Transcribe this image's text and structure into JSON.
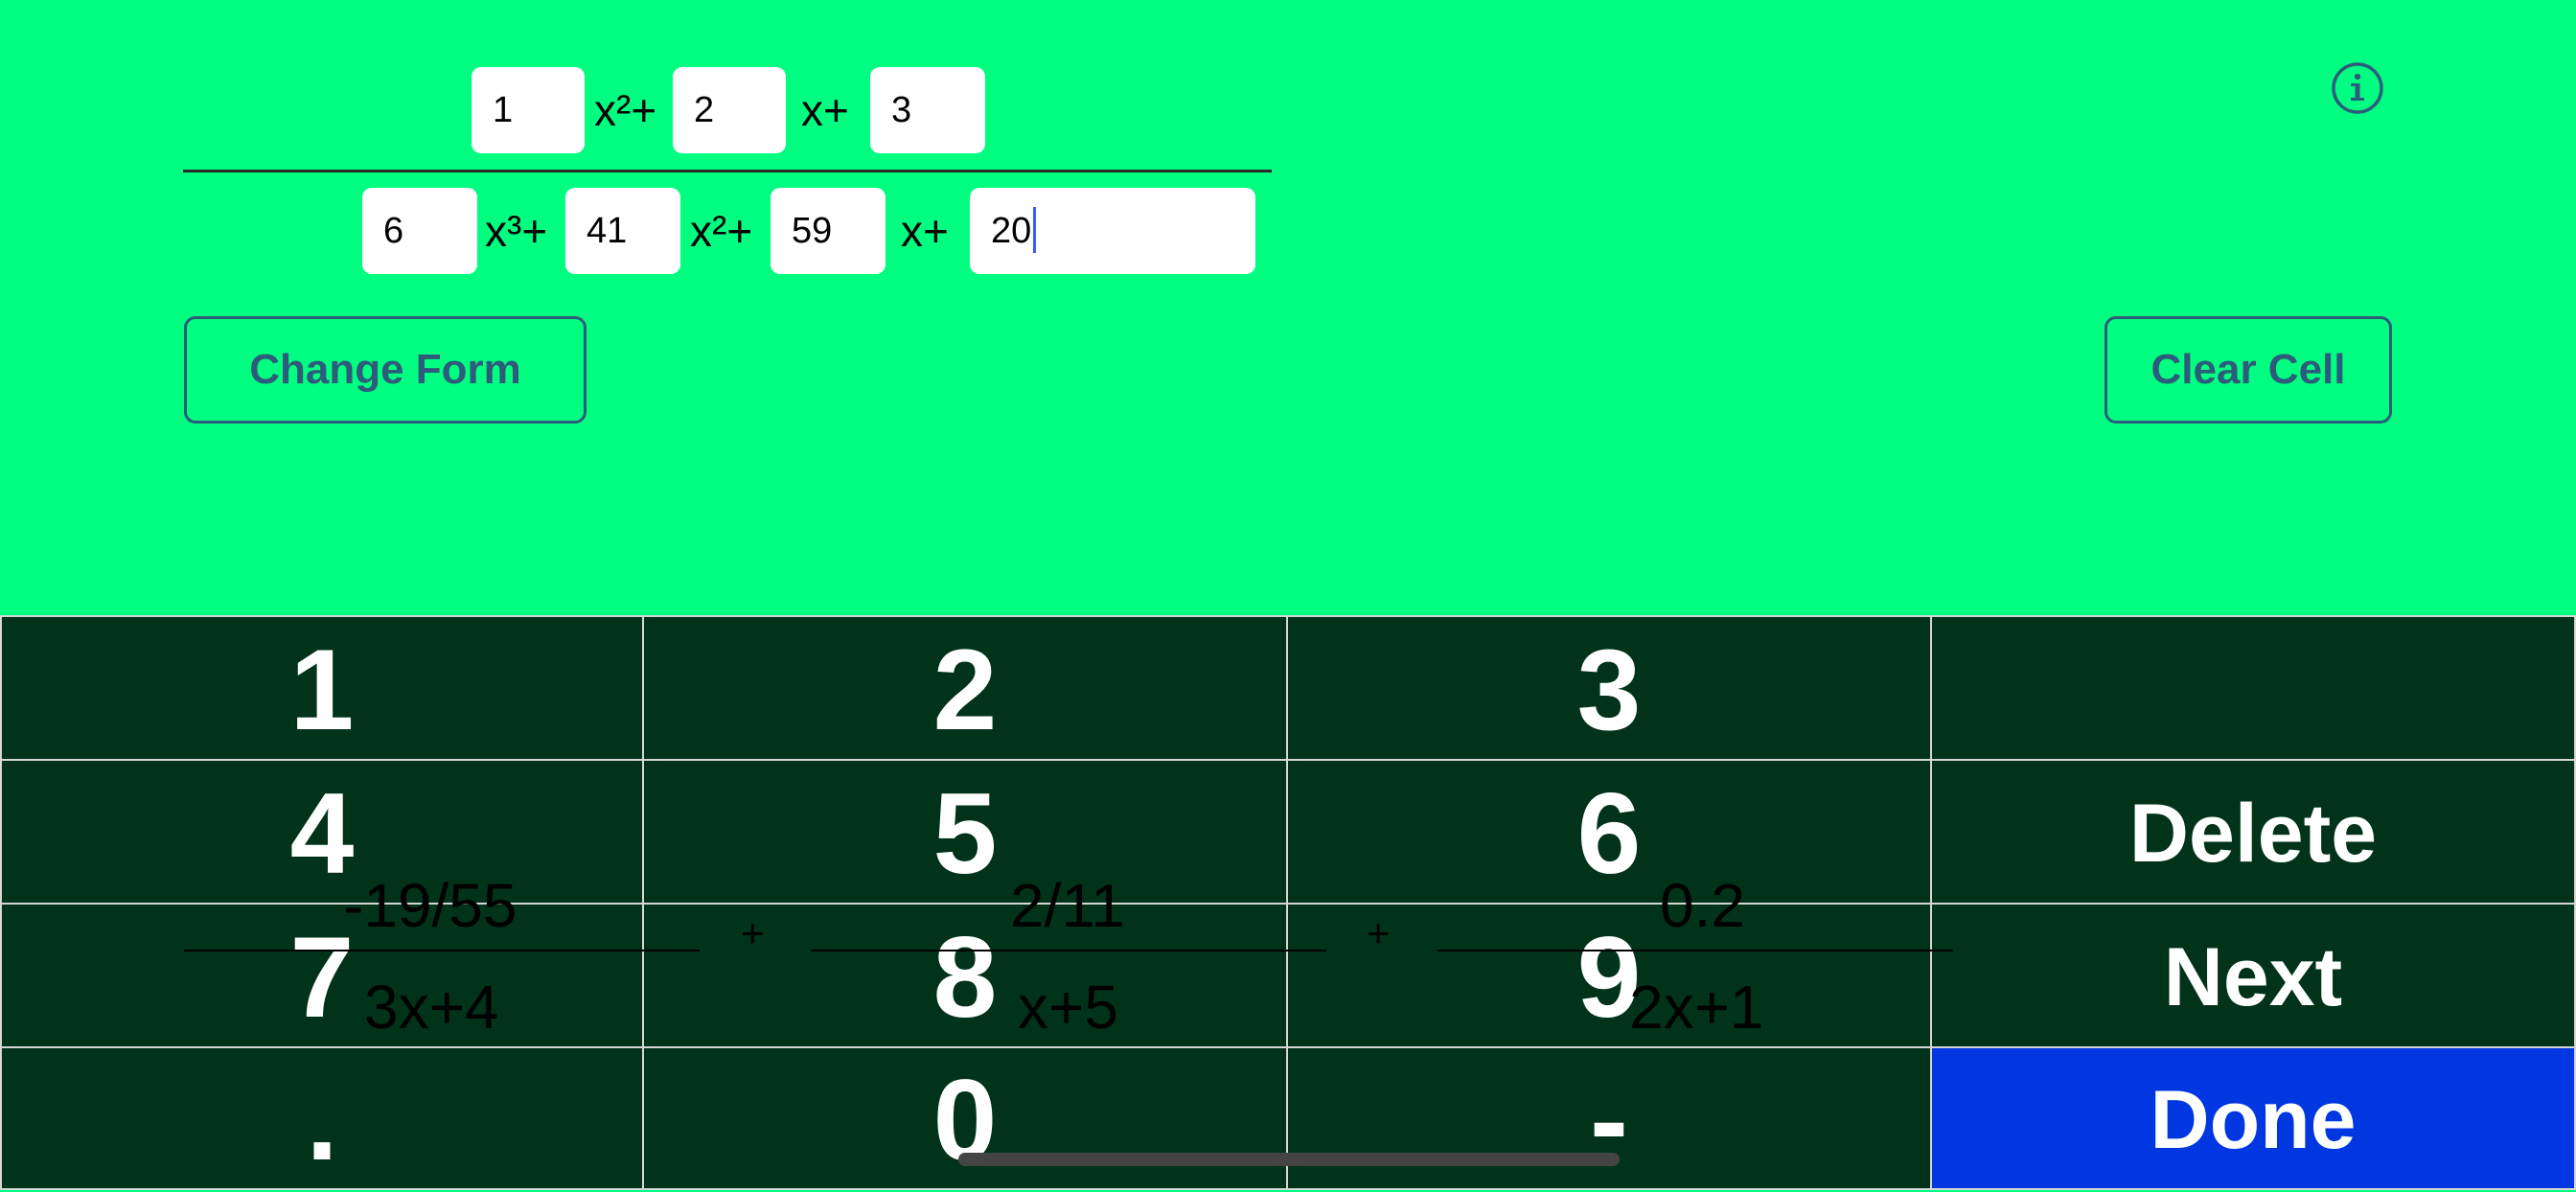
{
  "expression": {
    "numerator": {
      "a": "1",
      "term_a": "x²+",
      "b": "2",
      "term_b": "x+",
      "c": "3"
    },
    "denominator": {
      "a": "6",
      "term_a": "x³+",
      "b": "41",
      "term_b": "x²+",
      "c": "59",
      "term_c": "x+",
      "d": "20"
    }
  },
  "buttons": {
    "change_form": "Change Form",
    "clear_cell": "Clear Cell"
  },
  "result": {
    "terms": [
      {
        "numerator": "-19/55",
        "denominator": "3x+4"
      },
      {
        "numerator": "2/11",
        "denominator": "x+5"
      },
      {
        "numerator": "0.2",
        "denominator": "2x+1"
      }
    ],
    "plus": "+"
  },
  "keypad": {
    "k1": "1",
    "k2": "2",
    "k3": "3",
    "k4": "4",
    "k5": "5",
    "k6": "6",
    "k7": "7",
    "k8": "8",
    "k9": "9",
    "kdot": ".",
    "k0": "0",
    "kminus": "-",
    "delete": "Delete",
    "next": "Next",
    "done": "Done"
  },
  "colors": {
    "background": "#00FF80",
    "keypad": "#003319",
    "done": "#0037E0",
    "button_border": "#2E5B7C"
  },
  "icons": {
    "info": "info-icon"
  }
}
